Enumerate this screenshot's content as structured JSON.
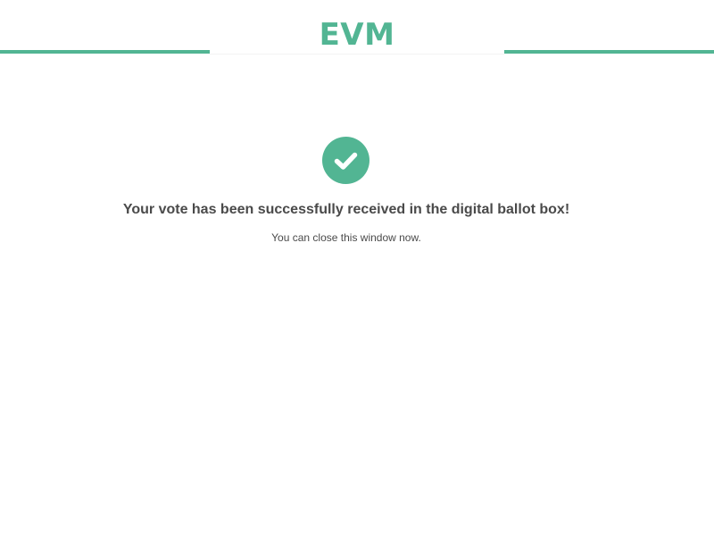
{
  "header": {
    "logo_text": "EVM",
    "accent_color": "#52b593"
  },
  "main": {
    "status_icon": "checkmark-circle-icon",
    "message": "Your vote has been successfully received in the digital ballot box!",
    "sub_message": "You can close this window now."
  }
}
